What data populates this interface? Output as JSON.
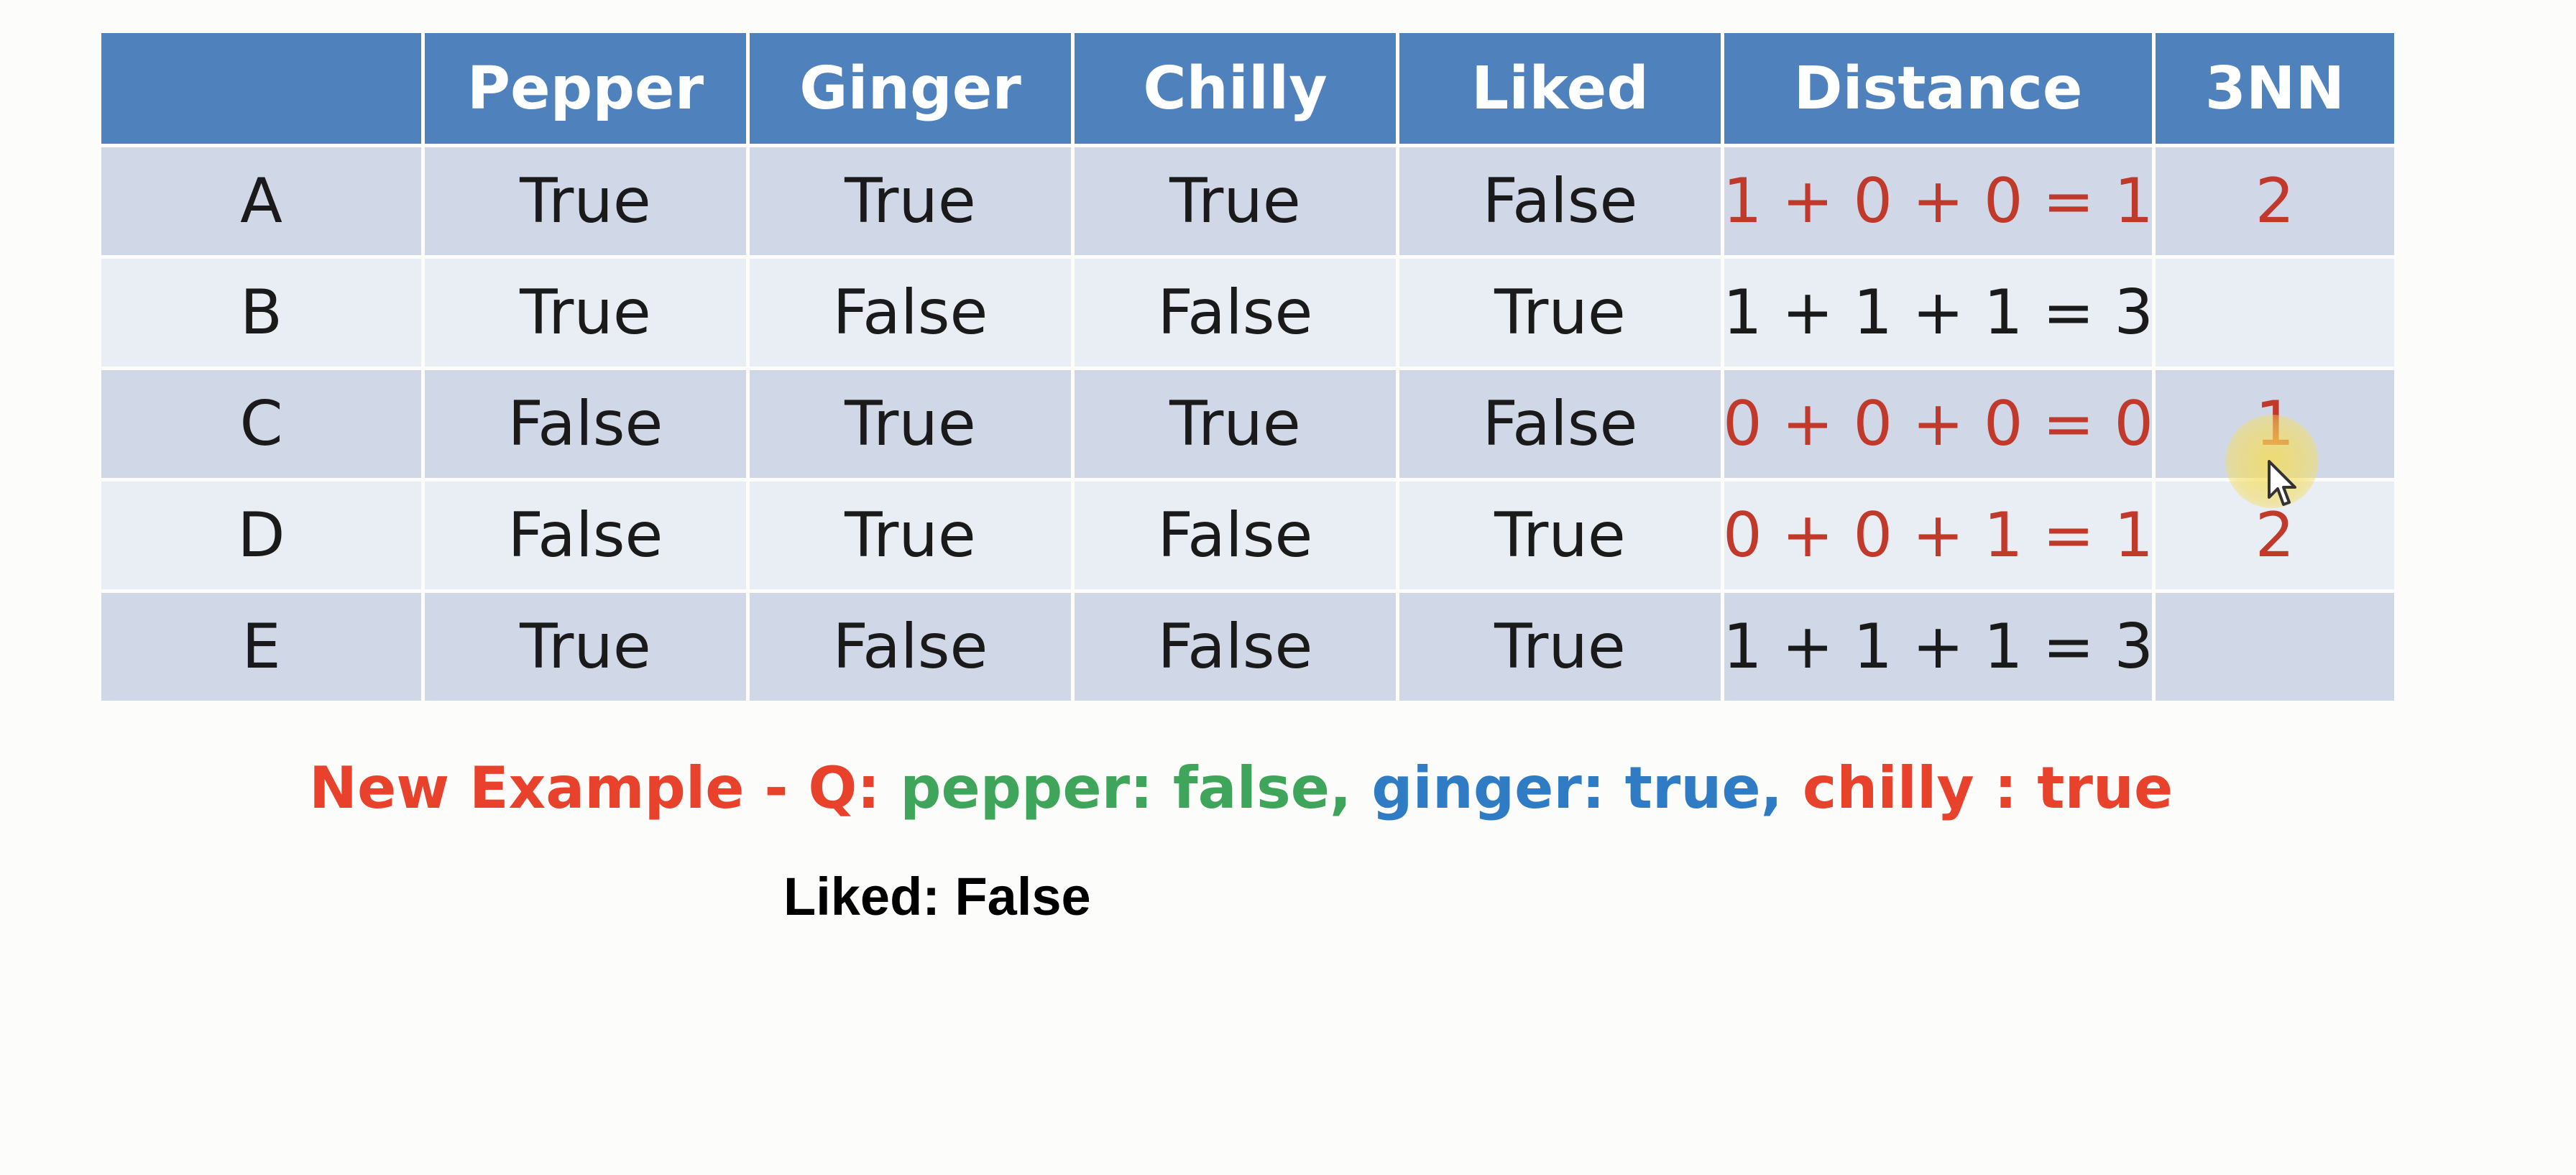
{
  "table": {
    "headers": [
      "",
      "Pepper",
      "Ginger",
      "Chilly",
      "Liked",
      "Distance",
      "3NN"
    ],
    "rows": [
      {
        "label": "A",
        "pepper": "True",
        "ginger": "True",
        "chilly": "True",
        "liked": "False",
        "distance": "1 + 0 + 0 = 1",
        "nn": "2",
        "highlight": true
      },
      {
        "label": "B",
        "pepper": "True",
        "ginger": "False",
        "chilly": "False",
        "liked": "True",
        "distance": "1 + 1 + 1 = 3",
        "nn": "",
        "highlight": false
      },
      {
        "label": "C",
        "pepper": "False",
        "ginger": "True",
        "chilly": "True",
        "liked": "False",
        "distance": "0 + 0 + 0 = 0",
        "nn": "1",
        "highlight": true
      },
      {
        "label": "D",
        "pepper": "False",
        "ginger": "True",
        "chilly": "False",
        "liked": "True",
        "distance": "0 + 0 + 1 = 1",
        "nn": "2",
        "highlight": true
      },
      {
        "label": "E",
        "pepper": "True",
        "ginger": "False",
        "chilly": "False",
        "liked": "True",
        "distance": "1 + 1 + 1 = 3",
        "nn": "",
        "highlight": false
      }
    ]
  },
  "caption": {
    "prefix": "New Example - Q: ",
    "pepper": "pepper: false, ",
    "ginger": "ginger: true, ",
    "chilly": "chilly : true"
  },
  "answer": "Liked: False",
  "colors": {
    "header_bg": "#4f81bd",
    "row_dark": "#d0d8e8",
    "row_light": "#e9edf4",
    "red": "#c0392b",
    "caption_red": "#e8412c",
    "caption_green": "#3fa55b",
    "caption_blue": "#2f7cc5"
  }
}
